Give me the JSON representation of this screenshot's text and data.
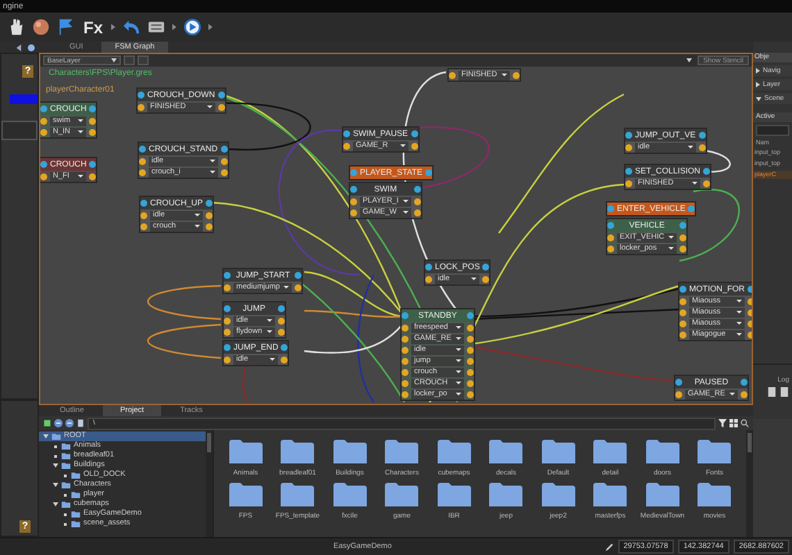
{
  "window": {
    "title": "ngine"
  },
  "toolbar": {
    "fx_label": "Fx"
  },
  "left_panel": {
    "help_label": "?",
    "bottom_help_label": "?"
  },
  "editor_tabs": [
    {
      "label": "GUI",
      "selected": false
    },
    {
      "label": "FSM Graph",
      "selected": true
    }
  ],
  "graph": {
    "layer": "BaseLayer",
    "stencil_button": "Show Stencil",
    "file_path": "Characters\\FPS\\Player.gres",
    "object_label": "playerCharacter01",
    "nodes": [
      {
        "title": "CROUCH",
        "kind": "start",
        "outputs": [
          "swim",
          "N_IN"
        ]
      },
      {
        "title": "CROUCH_DOWN",
        "kind": "state",
        "outputs": [
          "FINISHED"
        ]
      },
      {
        "title": "CROUCH_STAND",
        "kind": "state",
        "outputs": [
          "idle",
          "crouch_i"
        ]
      },
      {
        "title": "CROUCH",
        "kind": "exit",
        "outputs": [
          "N_FI"
        ]
      },
      {
        "title": "CROUCH_UP",
        "kind": "state",
        "outputs": [
          "idle",
          "crouch"
        ]
      },
      {
        "title": "SWIM_PAUSE",
        "kind": "state",
        "outputs": [
          "GAME_R"
        ]
      },
      {
        "title": "PLAYER_STATE",
        "kind": "event"
      },
      {
        "title": "SWIM",
        "kind": "state",
        "outputs": [
          "PLAYER_I",
          "GAME_W"
        ]
      },
      {
        "kind": "state",
        "outputs": [
          "FINISHED"
        ]
      },
      {
        "title": "JUMP_OUT_VE",
        "kind": "state",
        "outputs": [
          "idle"
        ]
      },
      {
        "title": "SET_COLLISION",
        "kind": "state",
        "outputs": [
          "FINISHED"
        ]
      },
      {
        "title": "ENTER_VEHICLE",
        "kind": "event"
      },
      {
        "title": "VEHICLE",
        "kind": "start",
        "outputs": [
          "EXIT_VEHIC",
          "locker_pos"
        ]
      },
      {
        "title": "JUMP_START",
        "kind": "state",
        "outputs": [
          "mediumjump"
        ]
      },
      {
        "title": "JUMP",
        "kind": "state",
        "outputs": [
          "idle",
          "flydown"
        ]
      },
      {
        "title": "JUMP_END",
        "kind": "state",
        "outputs": [
          "idle"
        ]
      },
      {
        "title": "LOCK_POS",
        "kind": "state",
        "outputs": [
          "idle"
        ]
      },
      {
        "title": "STANDBY",
        "kind": "start",
        "outputs": [
          "freespeed",
          "GAME_RE",
          "idle",
          "jump",
          "crouch",
          "CROUCH",
          "locker_po"
        ]
      },
      {
        "title": "MOTION_FOR",
        "kind": "state",
        "outputs": [
          "Miaouss",
          "Miaouss",
          "Miaouss",
          "Miagogue"
        ]
      },
      {
        "title": "PAUSED",
        "kind": "state",
        "outputs": [
          "GAME_RE"
        ]
      }
    ]
  },
  "right_panel": {
    "tab": "Obje",
    "sections": [
      {
        "label": "Navig",
        "expanded": false
      },
      {
        "label": "Layer",
        "expanded": false
      },
      {
        "label": "Scene",
        "expanded": true
      }
    ],
    "subtab": "Active",
    "list_header": "Nam",
    "list": [
      {
        "label": "input_top",
        "selected": false
      },
      {
        "label": "input_top",
        "selected": false
      },
      {
        "label": "playerC",
        "selected": true
      }
    ],
    "log_title": "Log"
  },
  "bottom_tabs": [
    {
      "label": "Outline",
      "selected": false
    },
    {
      "label": "Project",
      "selected": true
    },
    {
      "label": "Tracks",
      "selected": false
    }
  ],
  "project_path": "\\",
  "tree": [
    {
      "label": "ROOT",
      "selected": true,
      "expanded": true,
      "children": [
        {
          "label": "Animals",
          "selected": false
        },
        {
          "label": "breadleaf01",
          "selected": false
        },
        {
          "label": "Buildings",
          "selected": false,
          "expanded": true,
          "children": [
            {
              "label": "OLD_DOCK",
              "selected": false
            }
          ]
        },
        {
          "label": "Characters",
          "selected": false,
          "expanded": true,
          "children": [
            {
              "label": "player",
              "selected": false
            }
          ]
        },
        {
          "label": "cubemaps",
          "selected": false,
          "expanded": true,
          "children": [
            {
              "label": "EasyGameDemo",
              "selected": false
            },
            {
              "label": "scene_assets",
              "selected": false
            }
          ]
        }
      ]
    }
  ],
  "folders": [
    "Animals",
    "breadleaf01",
    "Buildings",
    "Characters",
    "cubemaps",
    "decals",
    "Default",
    "detail",
    "doors",
    "Fonts",
    "FPS",
    "FPS_template",
    "fxcile",
    "game",
    "IBR",
    "jeep",
    "jeep2",
    "masterfps",
    "MedievalTown",
    "movies"
  ],
  "status_bar": {
    "project": "EasyGameDemo",
    "readouts": [
      "29753.07578",
      "142.382744",
      "2682.887602"
    ]
  }
}
